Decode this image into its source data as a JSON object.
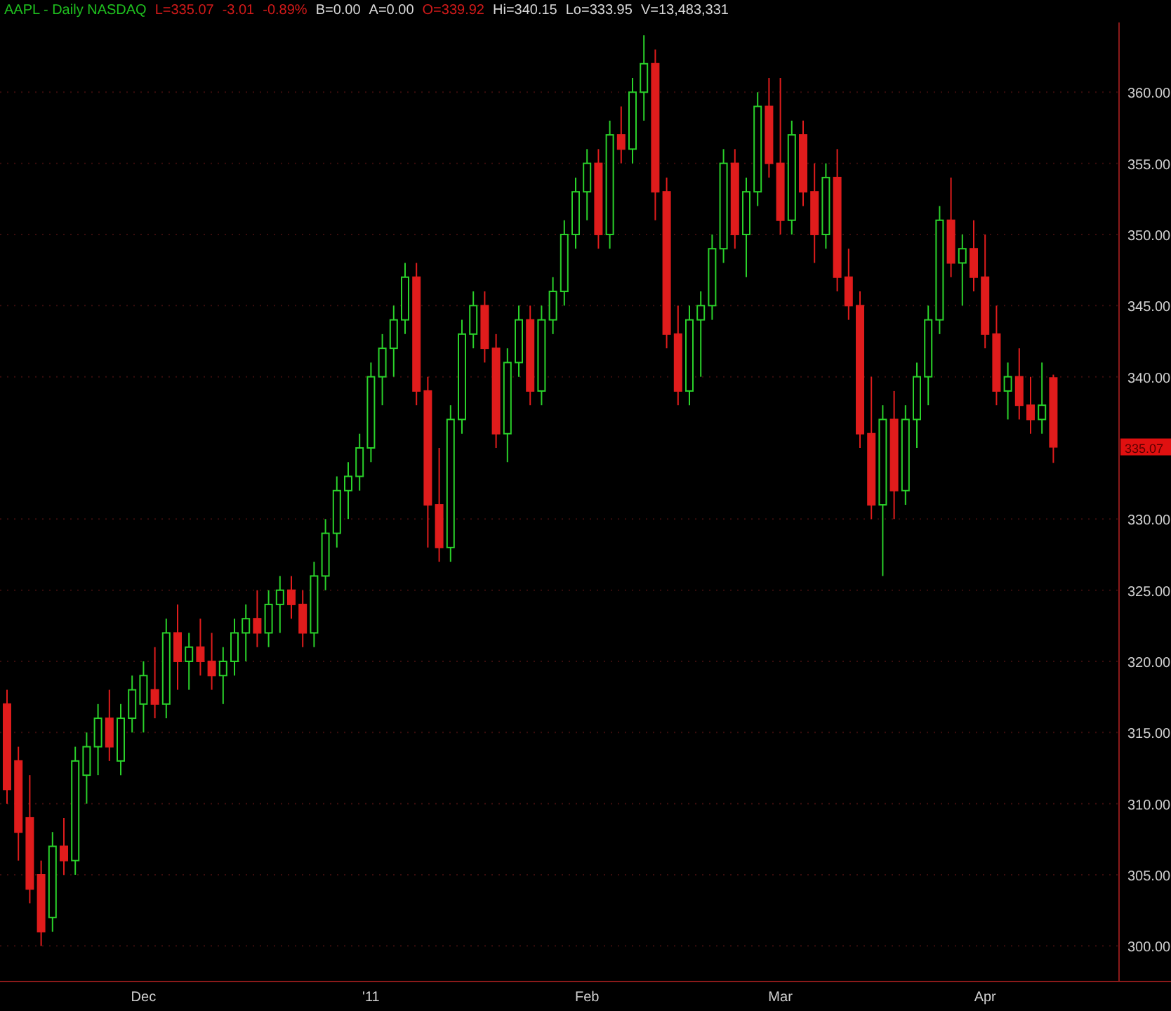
{
  "header": {
    "title": "AAPL - Daily NASDAQ",
    "quote": [
      {
        "text": "L=335.07",
        "color": "#d21a1a"
      },
      {
        "text": "-3.01",
        "color": "#d21a1a"
      },
      {
        "text": "-0.89%",
        "color": "#d21a1a"
      },
      {
        "text": "B=0.00",
        "color": "#d8d8d8"
      },
      {
        "text": "A=0.00",
        "color": "#d8d8d8"
      },
      {
        "text": "O=339.92",
        "color": "#d21a1a"
      },
      {
        "text": "Hi=340.15",
        "color": "#d8d8d8"
      },
      {
        "text": "Lo=333.95",
        "color": "#d8d8d8"
      },
      {
        "text": "V=13,483,331",
        "color": "#d8d8d8"
      }
    ]
  },
  "chart": {
    "last_price": "335.07",
    "chart_data": {
      "type": "candlestick",
      "categories": [
        null,
        null,
        null,
        null,
        null,
        null,
        null,
        null,
        null,
        null,
        null,
        null,
        "Dec",
        null,
        null,
        null,
        null,
        null,
        null,
        null,
        null,
        null,
        null,
        null,
        null,
        null,
        null,
        null,
        null,
        null,
        null,
        null,
        "'11",
        null,
        null,
        null,
        null,
        null,
        null,
        null,
        null,
        null,
        null,
        null,
        null,
        null,
        null,
        null,
        null,
        null,
        null,
        "Feb",
        null,
        null,
        null,
        null,
        null,
        null,
        null,
        null,
        null,
        null,
        null,
        null,
        null,
        null,
        null,
        null,
        "Mar",
        null,
        null,
        null,
        null,
        null,
        null,
        null,
        null,
        null,
        null,
        null,
        null,
        null,
        null,
        null,
        null,
        null,
        "Apr",
        null,
        null,
        null,
        null,
        null,
        null
      ],
      "ylim": [
        297.5,
        364.9
      ],
      "grid": true,
      "ohlc": [
        [
          317,
          318,
          310,
          311
        ],
        [
          313,
          314,
          306,
          308
        ],
        [
          309,
          312,
          303,
          304
        ],
        [
          305,
          306,
          300,
          301
        ],
        [
          302,
          308,
          301,
          307
        ],
        [
          307,
          309,
          305,
          306
        ],
        [
          306,
          314,
          305,
          313
        ],
        [
          312,
          315,
          310,
          314
        ],
        [
          314,
          317,
          312,
          316
        ],
        [
          316,
          318,
          313,
          314
        ],
        [
          313,
          317,
          312,
          316
        ],
        [
          316,
          319,
          315,
          318
        ],
        [
          317,
          320,
          315,
          319
        ],
        [
          318,
          321,
          316,
          317
        ],
        [
          317,
          323,
          316,
          322
        ],
        [
          322,
          324,
          318,
          320
        ],
        [
          320,
          322,
          318,
          321
        ],
        [
          321,
          323,
          319,
          320
        ],
        [
          320,
          322,
          318,
          319
        ],
        [
          319,
          321,
          317,
          320
        ],
        [
          320,
          323,
          319,
          322
        ],
        [
          322,
          324,
          320,
          323
        ],
        [
          323,
          325,
          321,
          322
        ],
        [
          322,
          325,
          321,
          324
        ],
        [
          324,
          326,
          322,
          325
        ],
        [
          325,
          326,
          323,
          324
        ],
        [
          324,
          325,
          321,
          322
        ],
        [
          322,
          327,
          321,
          326
        ],
        [
          326,
          330,
          325,
          329
        ],
        [
          329,
          333,
          328,
          332
        ],
        [
          332,
          334,
          330,
          333
        ],
        [
          333,
          336,
          332,
          335
        ],
        [
          335,
          341,
          334,
          340
        ],
        [
          340,
          343,
          338,
          342
        ],
        [
          342,
          345,
          340,
          344
        ],
        [
          344,
          348,
          343,
          347
        ],
        [
          347,
          348,
          338,
          339
        ],
        [
          339,
          340,
          328,
          331
        ],
        [
          331,
          335,
          327,
          328
        ],
        [
          328,
          338,
          327,
          337
        ],
        [
          337,
          344,
          336,
          343
        ],
        [
          343,
          346,
          342,
          345
        ],
        [
          345,
          346,
          341,
          342
        ],
        [
          342,
          343,
          335,
          336
        ],
        [
          336,
          342,
          334,
          341
        ],
        [
          341,
          345,
          340,
          344
        ],
        [
          344,
          345,
          338,
          339
        ],
        [
          339,
          345,
          338,
          344
        ],
        [
          344,
          347,
          343,
          346
        ],
        [
          346,
          351,
          345,
          350
        ],
        [
          350,
          354,
          349,
          353
        ],
        [
          353,
          356,
          351,
          355
        ],
        [
          355,
          356,
          349,
          350
        ],
        [
          350,
          358,
          349,
          357
        ],
        [
          357,
          359,
          355,
          356
        ],
        [
          356,
          361,
          355,
          360
        ],
        [
          360,
          364,
          358,
          362
        ],
        [
          362,
          363,
          351,
          353
        ],
        [
          353,
          354,
          342,
          343
        ],
        [
          343,
          345,
          338,
          339
        ],
        [
          339,
          345,
          338,
          344
        ],
        [
          344,
          346,
          340,
          345
        ],
        [
          345,
          350,
          344,
          349
        ],
        [
          349,
          356,
          348,
          355
        ],
        [
          355,
          356,
          349,
          350
        ],
        [
          350,
          354,
          347,
          353
        ],
        [
          353,
          360,
          352,
          359
        ],
        [
          359,
          361,
          354,
          355
        ],
        [
          355,
          361,
          350,
          351
        ],
        [
          351,
          358,
          350,
          357
        ],
        [
          357,
          358,
          352,
          353
        ],
        [
          353,
          355,
          348,
          350
        ],
        [
          350,
          355,
          349,
          354
        ],
        [
          354,
          356,
          346,
          347
        ],
        [
          347,
          349,
          344,
          345
        ],
        [
          345,
          346,
          335,
          336
        ],
        [
          336,
          340,
          330,
          331
        ],
        [
          331,
          338,
          326,
          337
        ],
        [
          337,
          339,
          330,
          332
        ],
        [
          332,
          338,
          331,
          337
        ],
        [
          337,
          341,
          335,
          340
        ],
        [
          340,
          345,
          338,
          344
        ],
        [
          344,
          352,
          343,
          351
        ],
        [
          351,
          354,
          347,
          348
        ],
        [
          348,
          350,
          345,
          349
        ],
        [
          349,
          351,
          346,
          347
        ],
        [
          347,
          350,
          342,
          343
        ],
        [
          343,
          345,
          338,
          339
        ],
        [
          339,
          341,
          337,
          340
        ],
        [
          340,
          342,
          337,
          338
        ],
        [
          338,
          340,
          336,
          337
        ],
        [
          337,
          341,
          336,
          338
        ],
        [
          339.92,
          340.15,
          333.95,
          335.07
        ]
      ],
      "yticks": [
        {
          "value": 360,
          "label": "360.00"
        },
        {
          "value": 355,
          "label": "355.00"
        },
        {
          "value": 350,
          "label": "350.00"
        },
        {
          "value": 345,
          "label": "345.00"
        },
        {
          "value": 340,
          "label": "340.00"
        },
        {
          "value": 330,
          "label": "330.00"
        },
        {
          "value": 325,
          "label": "325.00"
        },
        {
          "value": 320,
          "label": "320.00"
        },
        {
          "value": 315,
          "label": "315.00"
        },
        {
          "value": 310,
          "label": "310.00"
        },
        {
          "value": 305,
          "label": "305.00"
        },
        {
          "value": 300,
          "label": "300.00"
        }
      ]
    }
  }
}
